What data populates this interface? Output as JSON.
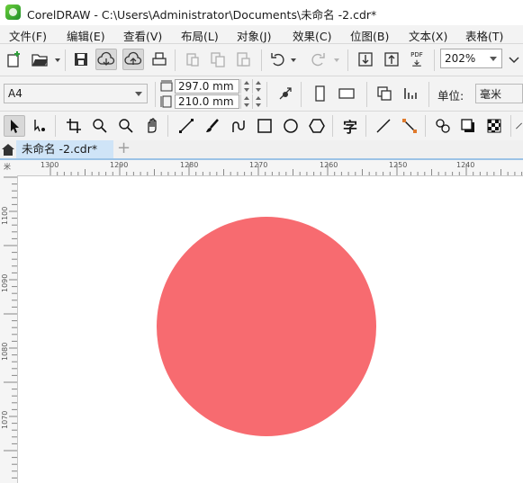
{
  "window": {
    "title": "CorelDRAW - C:\\Users\\Administrator\\Documents\\未命名 -2.cdr*"
  },
  "menu": [
    {
      "label": "文件(F)"
    },
    {
      "label": "编辑(E)"
    },
    {
      "label": "查看(V)"
    },
    {
      "label": "布局(L)"
    },
    {
      "label": "对象(J)"
    },
    {
      "label": "效果(C)"
    },
    {
      "label": "位图(B)"
    },
    {
      "label": "文本(X)"
    },
    {
      "label": "表格(T)"
    }
  ],
  "standard_toolbar": {
    "zoom_value": "202%",
    "icons": [
      "new-document-icon",
      "open-folder-icon",
      "save-icon",
      "cloud-import-icon",
      "cloud-export-icon",
      "print-icon",
      "cut-icon",
      "copy-icon",
      "paste-icon",
      "undo-icon",
      "redo-icon",
      "import-icon",
      "export-icon",
      "export-pdf-icon"
    ],
    "pdf_label": "PDF"
  },
  "property_bar": {
    "page_size": "A4",
    "width": "297.0 mm",
    "height": "210.0 mm",
    "units_label": "单位:",
    "units_value": "毫米"
  },
  "toolbox": {
    "icons": [
      "pick-tool-icon",
      "shape-tool-icon",
      "crop-tool-icon",
      "zoom-tool-icon",
      "zoom-out-icon",
      "pan-tool-icon",
      "freehand-tool-icon",
      "artistic-media-icon",
      "spiral-icon",
      "rectangle-tool-icon",
      "ellipse-tool-icon",
      "polygon-tool-icon",
      "text-tool-icon",
      "connector-tool-icon",
      "dimension-tool-icon",
      "blend-tool-icon",
      "drop-shadow-icon",
      "transparency-icon"
    ],
    "text_tool_glyph": "字"
  },
  "document_tab": {
    "label": "未命名 -2.cdr*",
    "add_tab": "+"
  },
  "ruler": {
    "horizontal_ticks": [
      "1300",
      "1290",
      "1280",
      "1270",
      "1260",
      "1250",
      "1240"
    ],
    "vertical_ticks": [
      "1100",
      "1090",
      "1080",
      "1070"
    ],
    "unit_glyph": "米"
  },
  "canvas": {
    "shape": "circle",
    "fill_color": "#f76b70"
  }
}
